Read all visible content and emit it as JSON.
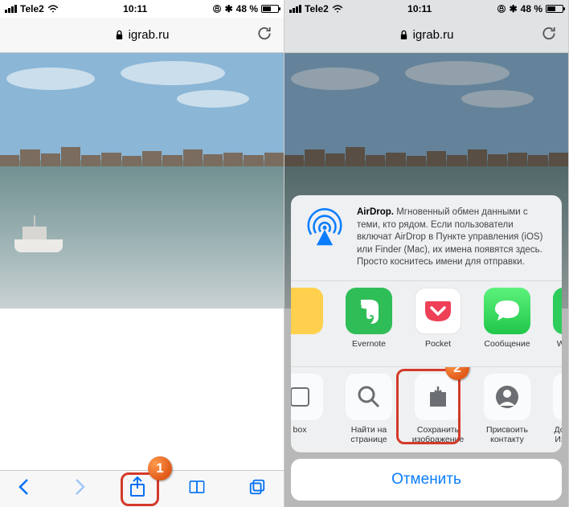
{
  "statusbar": {
    "carrier": "Tele2",
    "time": "10:11",
    "battery": "48 %"
  },
  "urlbar": {
    "domain": "igrab.ru"
  },
  "badges": {
    "one": "1",
    "two": "2"
  },
  "airdrop": {
    "title": "AirDrop.",
    "body": "Мгновенный обмен данными с теми, кто рядом. Если пользователи включат AirDrop в Пункте управления (iOS) или Finder (Mac), их имена появятся здесь. Просто коснитесь имени для отправки."
  },
  "apps": [
    {
      "label": "Evernote",
      "bg": "#2fbd57",
      "icon": "evernote"
    },
    {
      "label": "Pocket",
      "bg": "#ffffff",
      "icon": "pocket"
    },
    {
      "label": "Сообщение",
      "bg": "#34d35d",
      "icon": "message"
    },
    {
      "label": "WhatsApp",
      "bg": "#2ecc5b",
      "icon": "whatsapp"
    }
  ],
  "actions": [
    {
      "label": "box",
      "icon": "box"
    },
    {
      "label": "Найти на странице",
      "icon": "search"
    },
    {
      "label": "Сохранить изображение",
      "icon": "save-image"
    },
    {
      "label": "Присвоить контакту",
      "icon": "contact"
    },
    {
      "label": "Добавить в Избранное",
      "icon": "star"
    }
  ],
  "cancel": "Отменить"
}
